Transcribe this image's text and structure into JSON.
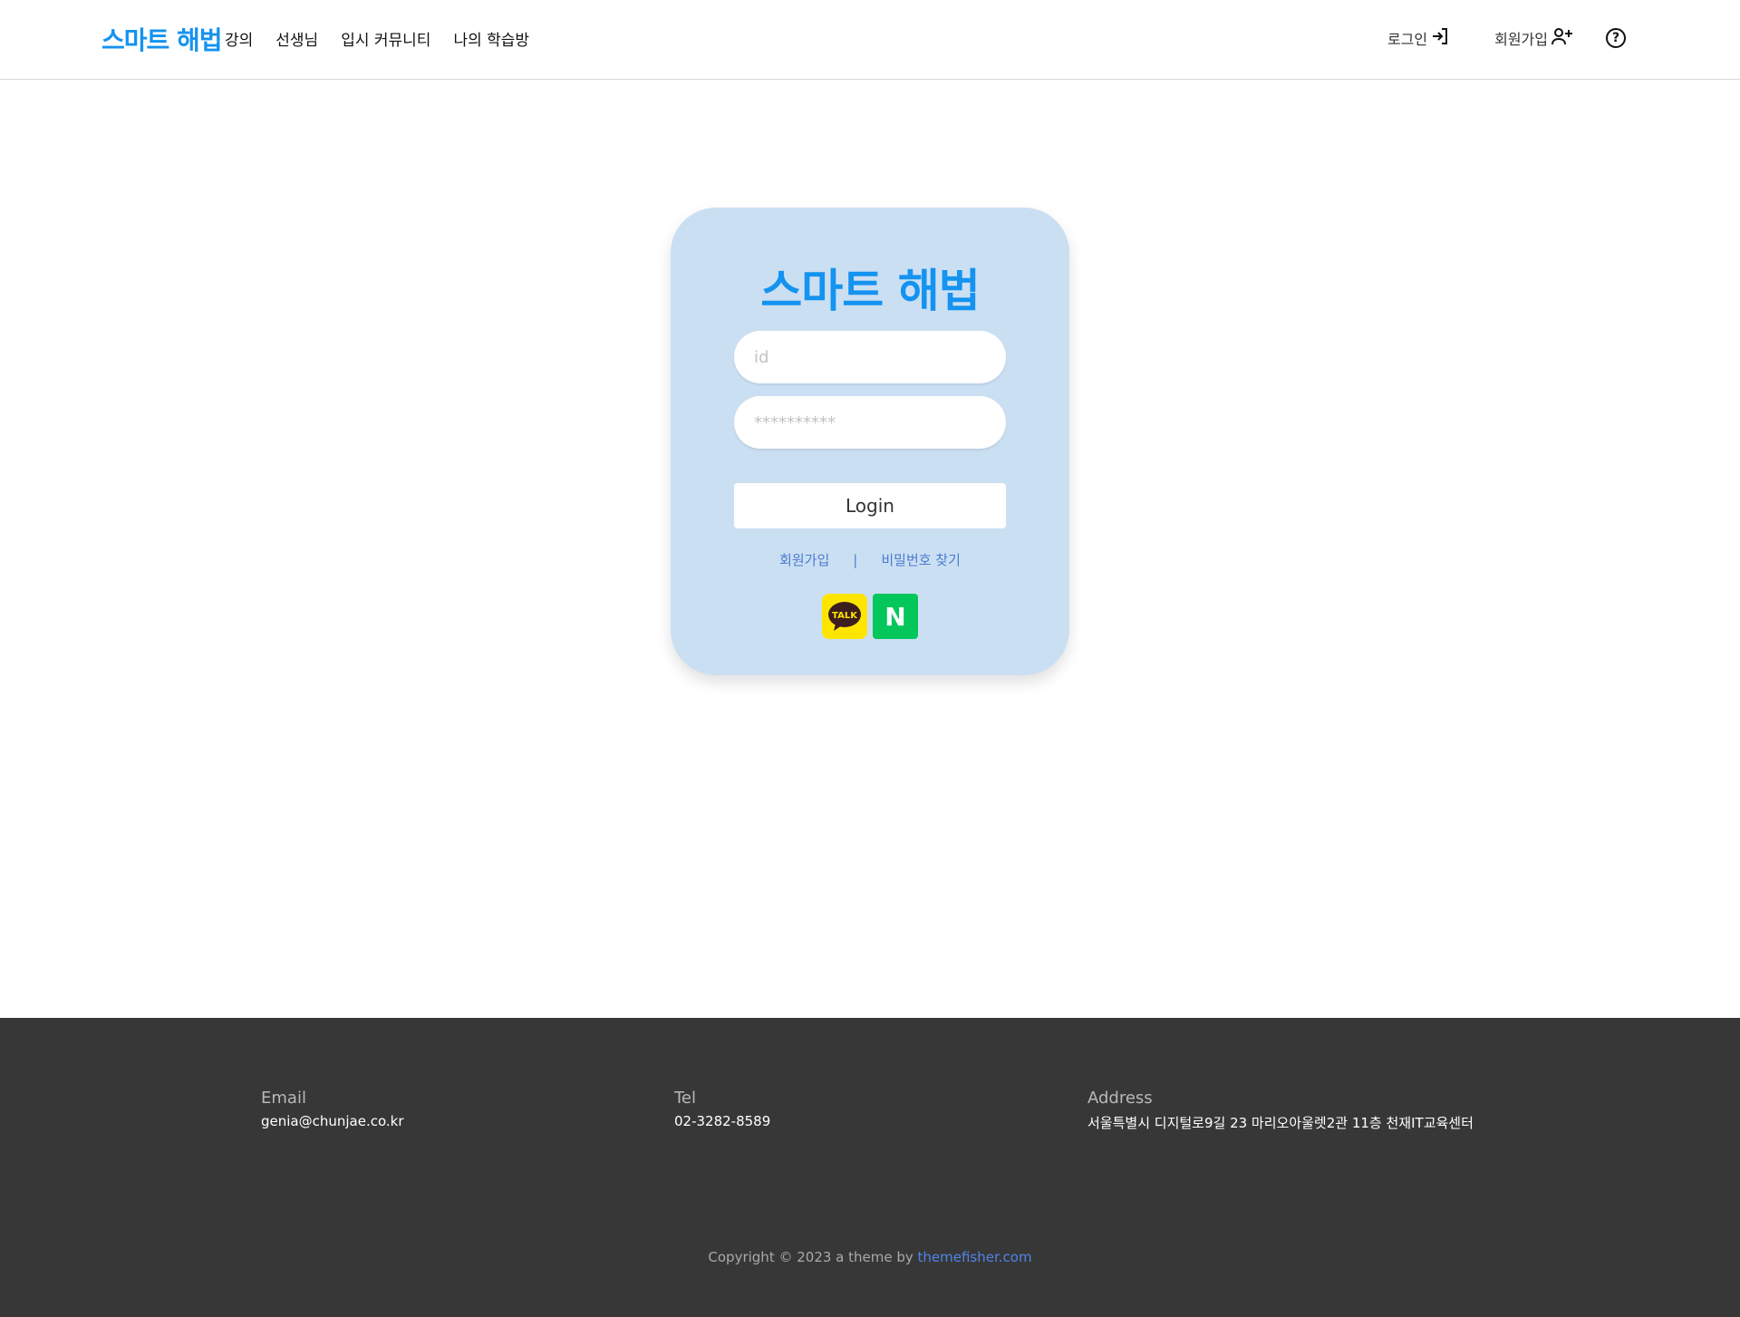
{
  "header": {
    "logo": "스마트 해법",
    "nav": [
      "강의",
      "선생님",
      "입시 커뮤니티",
      "나의 학습방"
    ],
    "login_label": "로그인",
    "signup_label": "회원가입",
    "help_icon": "?",
    "login_icon": "→]",
    "signup_icon": "👤+"
  },
  "login": {
    "logo": "스마트 해법",
    "id_placeholder": "id",
    "pw_placeholder": "**********",
    "button_label": "Login",
    "signup_link": "회원가입",
    "separator": "|",
    "find_pw_link": "비밀번호 찾기",
    "kakao_label": "TALK",
    "naver_label": "N"
  },
  "footer": {
    "email_label": "Email",
    "email_value": "genia@chunjae.co.kr",
    "tel_label": "Tel",
    "tel_value": "02-3282-8589",
    "address_label": "Address",
    "address_value": "서울특별시 디지털로9길 23 마리오아울렛2관 11층 천재IT교육센터",
    "copyright_prefix": "Copyright © 2023 a theme by ",
    "copyright_link": "themefisher.com"
  },
  "colors": {
    "brand": "#1493f0",
    "card_bg": "#cbdff3",
    "link": "#4a7bd0",
    "footer_bg": "#373737",
    "kakao": "#fee500",
    "naver": "#03c75a"
  }
}
